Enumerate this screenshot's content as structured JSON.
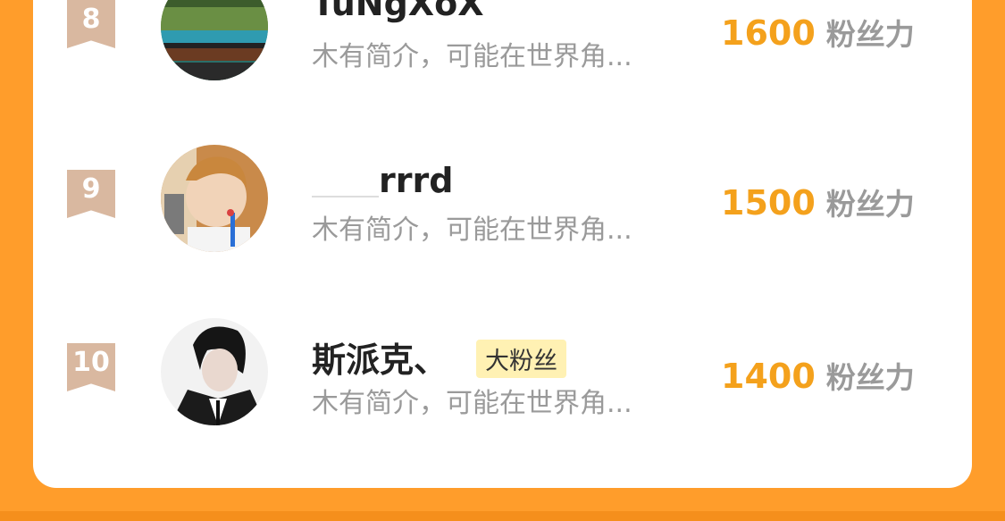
{
  "colors": {
    "background": "#FF9D2B",
    "card": "#ffffff",
    "rank_badge": "#D9B8A0",
    "score": "#F4A11C",
    "muted": "#9a9a9a",
    "tag_bg": "#FFF1B3"
  },
  "rankings": [
    {
      "rank": "8",
      "name": "TuNgXoX",
      "bio": "木有简介，可能在世界角...",
      "score": "1600",
      "unit": "粉丝力",
      "avatar": "landscape-lake-avatar"
    },
    {
      "rank": "9",
      "name": "rrrd",
      "bio": "木有简介，可能在世界角...",
      "score": "1500",
      "unit": "粉丝力",
      "avatar": "child-drinking-avatar"
    },
    {
      "rank": "10",
      "name": "斯派克、",
      "tag": "大粉丝",
      "bio": "木有简介，可能在世界角...",
      "score": "1400",
      "unit": "粉丝力",
      "avatar": "person-suit-avatar"
    }
  ]
}
